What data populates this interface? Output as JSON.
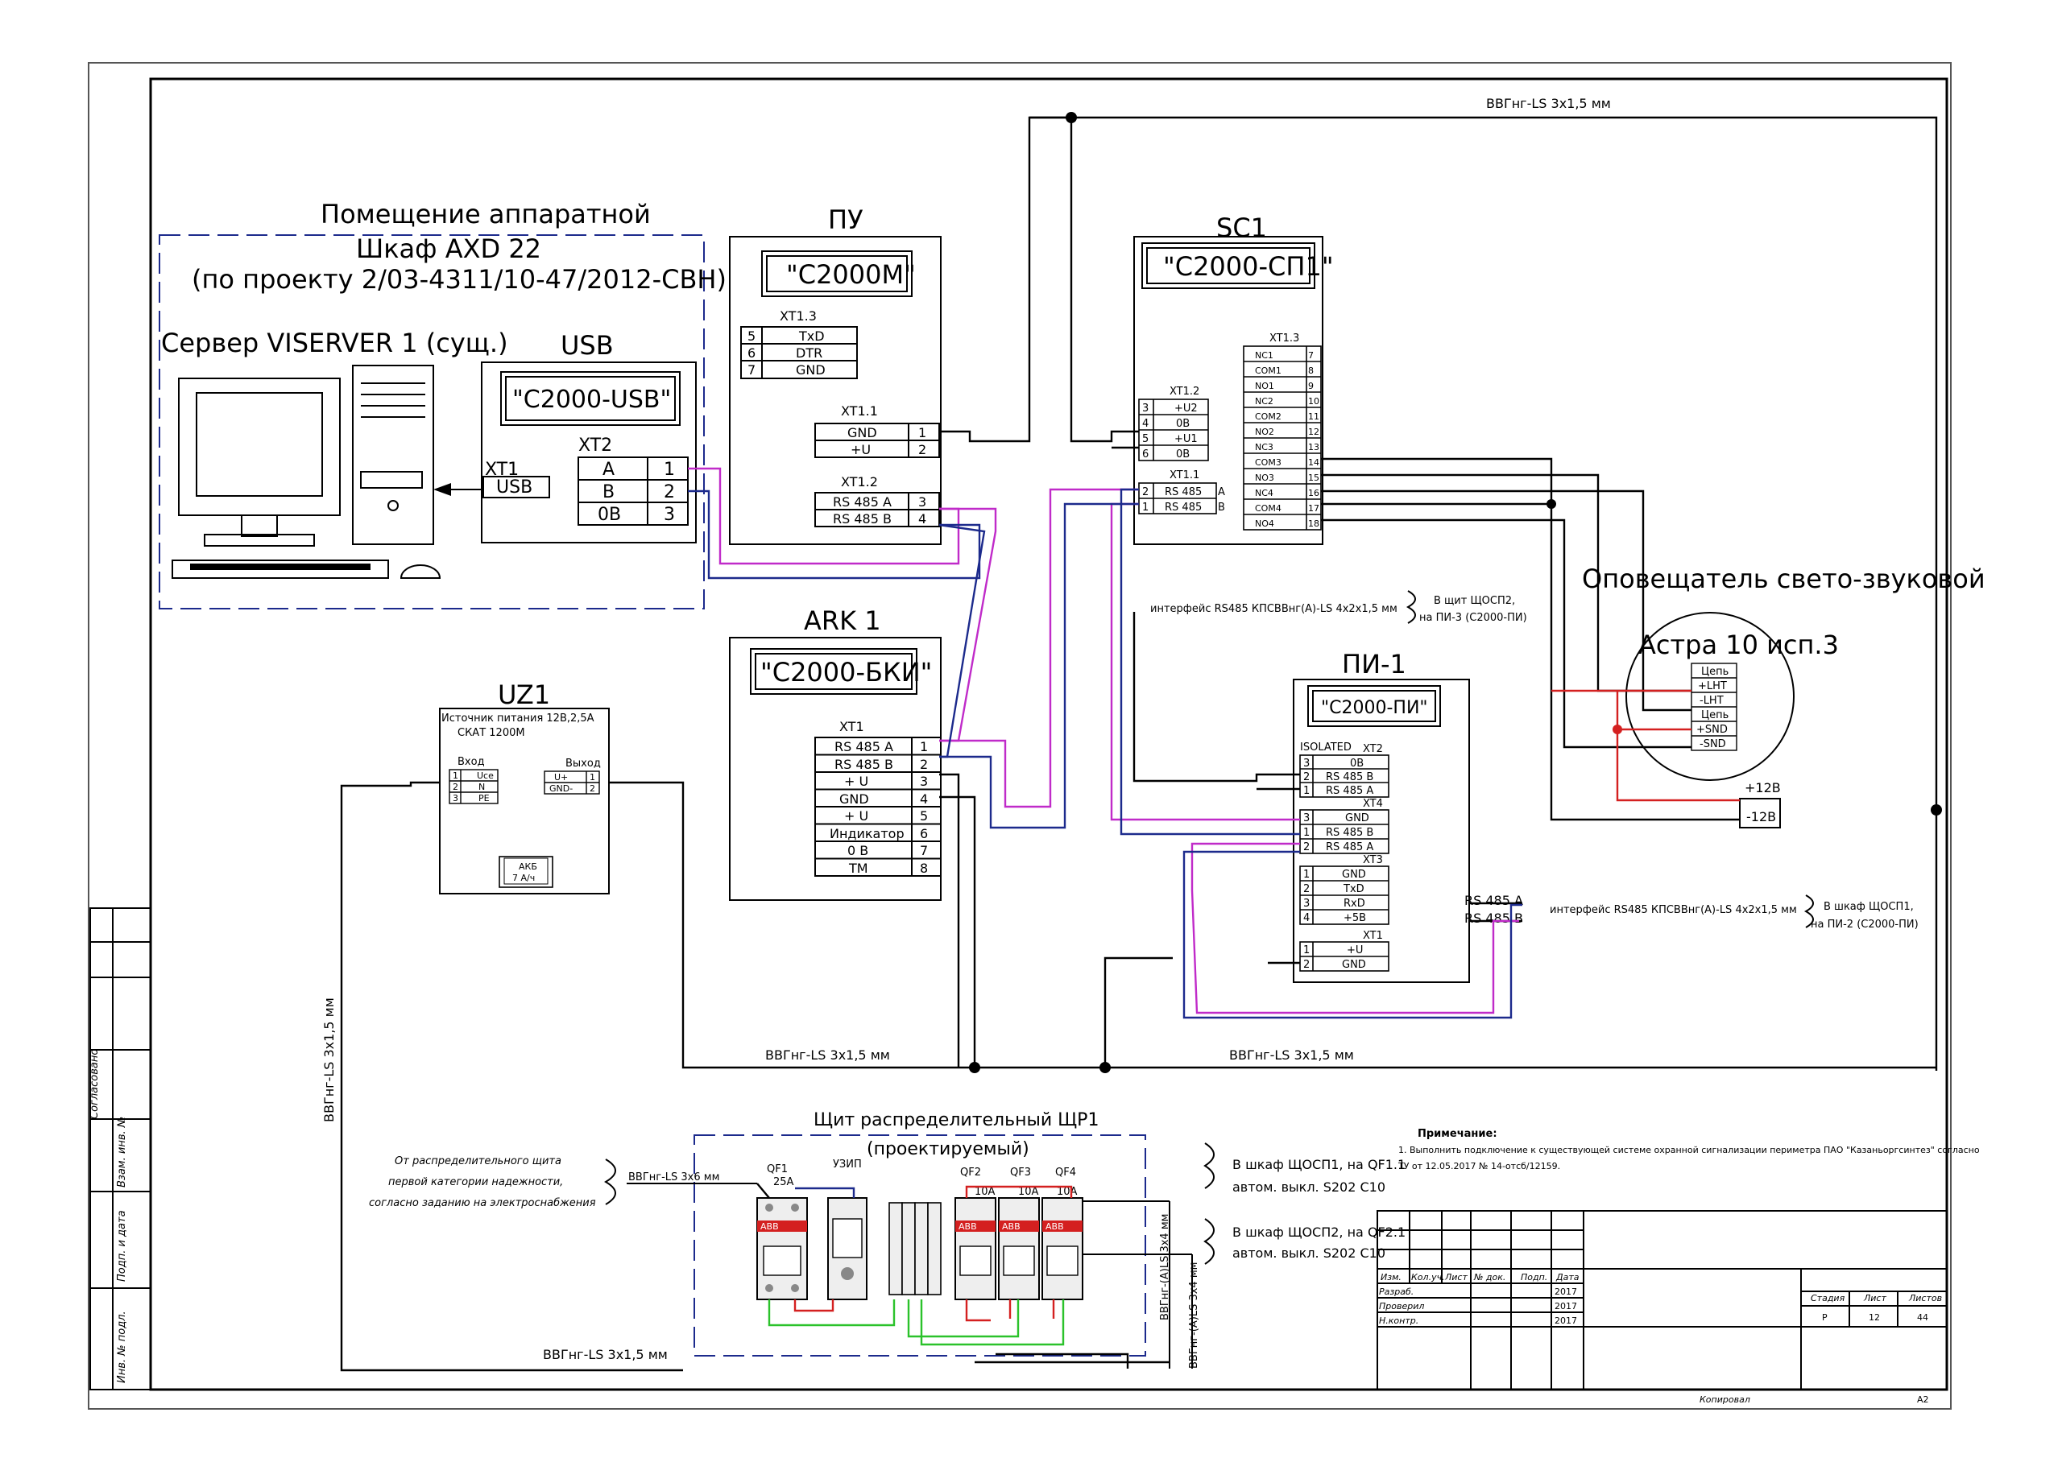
{
  "colors": {
    "black": "#000000",
    "magenta": "#c02bc9",
    "navy": "#1c2a8c",
    "red": "#d42020",
    "green": "#2bc22b",
    "dash": "#1c2a8c"
  },
  "cable_top": "ВВГнг-LS 3х1,5 мм",
  "cable_bottom_left": "ВВГнг-LS 3х1,5 мм",
  "cable_bottom_right": "ВВГнг-LS 3х1,5 мм",
  "cable_vertical_left": "ВВГнг-LS 3х1,5 мм",
  "cable_shield_bottom": "ВВГнг-LS 3х1,5 мм",
  "room": {
    "title": "Помещение аппаратной",
    "cabinet": "Шкаф AXD 22",
    "project": "(по проекту 2/03-4311/10-47/2012-СВН)",
    "server": "Сервер VISERVER 1 (сущ.)",
    "usb_title": "USB",
    "usb_device": "\"С2000-USB\"",
    "xt2": "XT2",
    "xt1": "XT1",
    "usb_port": "USB",
    "rows": [
      {
        "l": "A",
        "n": "1"
      },
      {
        "l": "B",
        "n": "2"
      },
      {
        "l": "0B",
        "n": "3"
      }
    ]
  },
  "pu": {
    "title": "ПУ",
    "device": "\"С2000М\"",
    "xt13": "XT1.3",
    "xt13_rows": [
      {
        "n": "5",
        "l": "TxD"
      },
      {
        "n": "6",
        "l": "DTR"
      },
      {
        "n": "7",
        "l": "GND"
      }
    ],
    "xt11": "XT1.1",
    "xt11_rows": [
      {
        "l": "GND",
        "n": "1"
      },
      {
        "l": "+U",
        "n": "2"
      }
    ],
    "xt12": "XT1.2",
    "xt12_rows": [
      {
        "l": "RS 485 A",
        "n": "3"
      },
      {
        "l": "RS 485 B",
        "n": "4"
      }
    ]
  },
  "ark": {
    "title": "ARK 1",
    "device": "\"С2000-БКИ\"",
    "xt1": "XT1",
    "rows": [
      {
        "l": "RS 485 A",
        "n": "1"
      },
      {
        "l": "RS 485 B",
        "n": "2"
      },
      {
        "l": "+ U",
        "n": "3"
      },
      {
        "l": "GND",
        "n": "4"
      },
      {
        "l": "+ U",
        "n": "5"
      },
      {
        "l": "Индикатор",
        "n": "6"
      },
      {
        "l": "0 В",
        "n": "7"
      },
      {
        "l": "ТМ",
        "n": "8"
      }
    ]
  },
  "sc1": {
    "title": "SC1",
    "device": "\"С2000-СП1\"",
    "xt13": "XT1.3",
    "xt13_rows": [
      {
        "l": "NC1",
        "n": "7"
      },
      {
        "l": "COM1",
        "n": "8"
      },
      {
        "l": "NO1",
        "n": "9"
      },
      {
        "l": "NC2",
        "n": "10"
      },
      {
        "l": "COM2",
        "n": "11"
      },
      {
        "l": "NO2",
        "n": "12"
      },
      {
        "l": "NC3",
        "n": "13"
      },
      {
        "l": "COM3",
        "n": "14"
      },
      {
        "l": "NO3",
        "n": "15"
      },
      {
        "l": "NC4",
        "n": "16"
      },
      {
        "l": "COM4",
        "n": "17"
      },
      {
        "l": "NO4",
        "n": "18"
      }
    ],
    "xt12": "XT1.2",
    "xt12_rows": [
      {
        "n": "3",
        "l": "+U2"
      },
      {
        "n": "4",
        "l": "0В"
      },
      {
        "n": "5",
        "l": "+U1"
      },
      {
        "n": "6",
        "l": "0В"
      }
    ],
    "xt11": "XT1.1",
    "xt11_rows": [
      {
        "n": "2",
        "l": "RS 485",
        "s": "A"
      },
      {
        "n": "1",
        "l": "RS 485",
        "s": "B"
      }
    ]
  },
  "pi1": {
    "title": "ПИ-1",
    "device": "\"С2000-ПИ\"",
    "isolated": "ISOLATED",
    "xt2": "XT2",
    "xt2_rows": [
      {
        "n": "3",
        "l": "0В"
      },
      {
        "n": "2",
        "l": "RS 485 B"
      },
      {
        "n": "1",
        "l": "RS 485 A"
      }
    ],
    "xt4": "XT4",
    "xt4_rows": [
      {
        "n": "3",
        "l": "GND"
      },
      {
        "n": "1",
        "l": "RS 485 B"
      },
      {
        "n": "2",
        "l": "RS 485 A"
      }
    ],
    "xt3": "XT3",
    "xt3_rows": [
      {
        "n": "1",
        "l": "GND"
      },
      {
        "n": "2",
        "l": "TxD"
      },
      {
        "n": "3",
        "l": "RxD"
      },
      {
        "n": "4",
        "l": "+5В"
      }
    ],
    "xt1": "XT1",
    "xt1_rows": [
      {
        "n": "1",
        "l": "+U"
      },
      {
        "n": "2",
        "l": "GND"
      }
    ],
    "rs_a": "RS 485 A",
    "rs_b": "RS 485 B"
  },
  "uz1": {
    "title": "UZ1",
    "line1": "Источник питания 12В,2,5А",
    "line2": "СКАТ 1200М",
    "in": "Вход",
    "out": "Выход",
    "in_rows": [
      {
        "n": "1",
        "l": "Uсе"
      },
      {
        "n": "2",
        "l": "N"
      },
      {
        "n": "3",
        "l": "PE"
      }
    ],
    "out_rows": [
      {
        "l": "U+",
        "n": "1"
      },
      {
        "l": "GND-",
        "n": "2"
      }
    ],
    "akb": "АКБ",
    "akb2": "7 А/ч"
  },
  "sounder": {
    "title": "Оповещатель свето-звуковой",
    "name": "Астра 10 исп.3",
    "rows": [
      "Цепь",
      "+LHT",
      "-LHT",
      "Цепь",
      "+SND",
      "-SND"
    ],
    "plus12": "+12В",
    "minus12": "-12В"
  },
  "iface1": {
    "cable": "интерфейс RS485 КПСВВнг(А)-LS 4х2х1,5 мм",
    "dest1": "В щит ЩОСП2,",
    "dest2": "на ПИ-3 (С2000-ПИ)"
  },
  "iface2": {
    "cable": "интерфейс RS485 КПСВВнг(А)-LS 4х2х1,5 мм",
    "dest1": "В шкаф ЩОСП1,",
    "dest2": "на ПИ-2 (С2000-ПИ)"
  },
  "panel": {
    "title": "Щит распределительный ЩР1",
    "subtitle": "(проектируемый)",
    "from1": "От распределительного щита",
    "from2": "первой категории надежности,",
    "from3": "согласно заданию на электроснабжения",
    "cable_in": "ВВГнг-LS 3х6 мм",
    "qf1": "QF1",
    "qf1_rating": "25А",
    "uzip": "УЗИП",
    "qf2": "QF2",
    "qf3": "QF3",
    "qf4": "QF4",
    "qf_ratings": [
      "10A",
      "10A",
      "10A"
    ],
    "to1a": "В шкаф ЩОСП1, на QF1.1",
    "to1b": "автом. выкл. S202 C10",
    "to2a": "В шкаф ЩОСП2, на QF2.1",
    "to2b": "автом. выкл. S202 C10",
    "cable_out1": "ВВГнг-(А)LS 3х4 мм",
    "cable_out2": "ВВГнг-(А)LS 3х4 мм",
    "abb": "ABB"
  },
  "note": {
    "title": "Примечание:",
    "line1": "1. Выполнить подключение к существующей системе охранной сигнализации периметра ПАО \"Казаньоргсинтез\" согласно",
    "line2": "ТУ от 12.05.2017 № 14-отсб/12159."
  },
  "title_block": {
    "headers": [
      "Изм.",
      "Кол.уч.",
      "Лист",
      "№ док.",
      "Подп.",
      "Дата"
    ],
    "roles": [
      {
        "r": "Разраб.",
        "d": "2017"
      },
      {
        "r": "Проверил",
        "d": "2017"
      },
      {
        "r": "Н.контр.",
        "d": "2017"
      }
    ],
    "stage_h": "Стадия",
    "sheet_h": "Лист",
    "sheets_h": "Листов",
    "stage": "Р",
    "sheet": "12",
    "sheets": "44",
    "copied": "Копировал",
    "format": "А2"
  },
  "side_stamp": [
    "Согласовано",
    "Взам. инв. №",
    "Подп. и дата",
    "Инв. № подл."
  ]
}
